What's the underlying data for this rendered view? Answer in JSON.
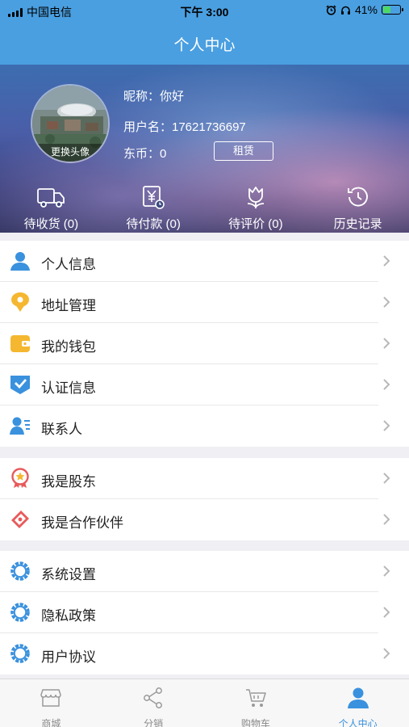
{
  "status_bar": {
    "carrier": "中国电信",
    "time": "下午 3:00",
    "battery_percent": "41%",
    "battery_level": 0.41,
    "icons": [
      "signal-icon",
      "alarm-icon",
      "headphones-icon",
      "battery-icon"
    ]
  },
  "header": {
    "title": "个人中心"
  },
  "profile": {
    "avatar_caption": "更换头像",
    "nickname": "昵称：你好",
    "username": "用户名：17621736697",
    "coins": "东币：0",
    "rent_button": "租赁"
  },
  "orders": [
    {
      "label": "待收货 (0)",
      "icon": "truck-icon"
    },
    {
      "label": "待付款 (0)",
      "icon": "yen-clock-icon"
    },
    {
      "label": "待评价 (0)",
      "icon": "tulip-icon"
    },
    {
      "label": "历史记录",
      "icon": "history-icon"
    }
  ],
  "menu_groups": [
    [
      {
        "label": "个人信息",
        "icon": "user-icon",
        "color": "#3a91de"
      },
      {
        "label": "地址管理",
        "icon": "location-pin-icon",
        "color": "#f5b730"
      },
      {
        "label": "我的钱包",
        "icon": "wallet-icon",
        "color": "#f5b730"
      },
      {
        "label": "认证信息",
        "icon": "verified-shield-icon",
        "color": "#3a91de"
      },
      {
        "label": "联系人",
        "icon": "contacts-icon",
        "color": "#3a91de"
      }
    ],
    [
      {
        "label": "我是股东",
        "icon": "award-badge-icon",
        "color": "#e85a5a"
      },
      {
        "label": "我是合作伙伴",
        "icon": "partner-tag-icon",
        "color": "#e85a5a"
      }
    ],
    [
      {
        "label": "系统设置",
        "icon": "gear-icon",
        "color": "#3a91de"
      },
      {
        "label": "隐私政策",
        "icon": "gear-icon",
        "color": "#3a91de"
      },
      {
        "label": "用户协议",
        "icon": "gear-icon",
        "color": "#3a91de"
      }
    ]
  ],
  "tabbar": [
    {
      "label": "商城",
      "icon": "store-icon",
      "active": false
    },
    {
      "label": "分销",
      "icon": "share-icon",
      "active": false
    },
    {
      "label": "购物车",
      "icon": "cart-icon",
      "active": false
    },
    {
      "label": "个人中心",
      "icon": "user-icon",
      "active": true
    }
  ],
  "colors": {
    "primary": "#4a9fe0",
    "active_tab": "#3a91de",
    "background": "#efeff4",
    "accent_yellow": "#f5b730",
    "accent_red": "#e85a5a"
  }
}
